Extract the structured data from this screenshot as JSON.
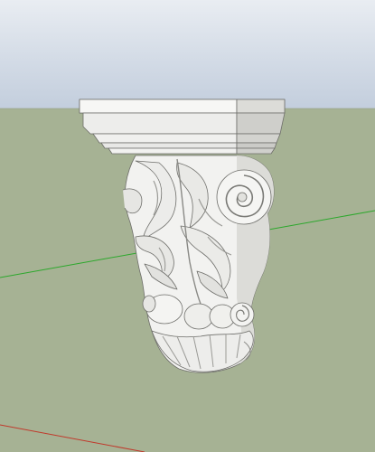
{
  "viewport": {
    "sky_color": "#d6dde8",
    "ground_color": "#a6b294",
    "axis_colors": {
      "green": "#2ca82c",
      "red": "#c0392b"
    }
  },
  "model": {
    "name": "corbel-icon",
    "fill_color": "#f2f2f0",
    "shade_color": "#c9c9c5"
  }
}
